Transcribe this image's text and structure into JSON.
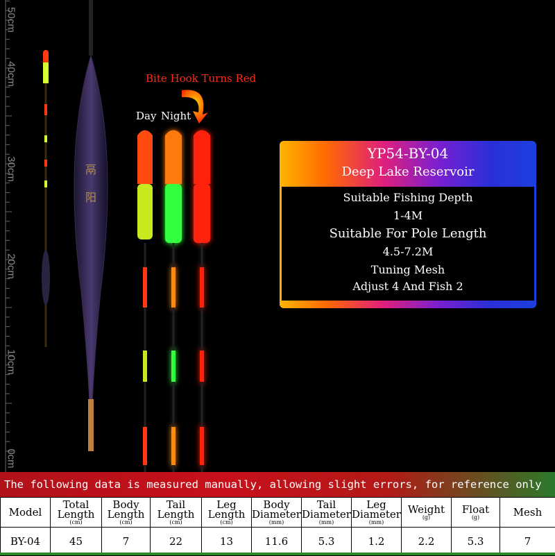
{
  "ruler": {
    "labels": [
      "50cm",
      "40cm",
      "30cm",
      "20cm",
      "10cm",
      "0cm"
    ]
  },
  "labels": {
    "bite": "Bite Hook Turns Red",
    "day": "Day",
    "night": "Night"
  },
  "card": {
    "model": "YP54-BY-04",
    "type": "Deep Lake Reservoir",
    "lines": [
      "Suitable Fishing Depth",
      "1-4M",
      "Suitable For Pole Length",
      "4.5-7.2M",
      "Tuning Mesh",
      "Adjust 4 And Fish 2"
    ]
  },
  "notice": "The following data is measured manually, allowing slight errors, for reference only",
  "table": {
    "headers": [
      {
        "label": "Model",
        "unit": ""
      },
      {
        "label": "Total Length",
        "unit": "(cm)"
      },
      {
        "label": "Body Length",
        "unit": "(cm)"
      },
      {
        "label": "Tail Length",
        "unit": "(cm)"
      },
      {
        "label": "Leg Length",
        "unit": "(cm)"
      },
      {
        "label": "Body Diameter",
        "unit": "(mm)"
      },
      {
        "label": "Tail Diameter",
        "unit": "(mm)"
      },
      {
        "label": "Leg Diameter",
        "unit": "(mm)"
      },
      {
        "label": "Weight",
        "unit": "(g)"
      },
      {
        "label": "Float",
        "unit": "(g)"
      },
      {
        "label": "Mesh",
        "unit": ""
      }
    ],
    "row": [
      "BY-04",
      "45",
      "7",
      "22",
      "13",
      "11.6",
      "5.3",
      "1.2",
      "2.2",
      "5.3",
      "7"
    ]
  },
  "colors": {
    "red": "#ff2a10",
    "yellow": "#d8ff30",
    "green": "#30ff40",
    "orange": "#ff7a10"
  }
}
